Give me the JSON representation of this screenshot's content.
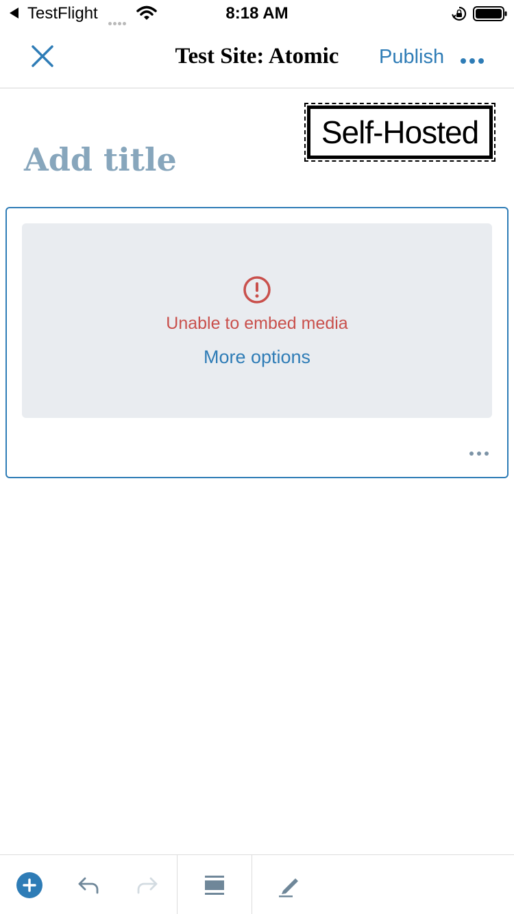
{
  "status_bar": {
    "back_app": "TestFlight",
    "time": "8:18 AM",
    "icons": [
      "back-arrow-icon",
      "signal-dots-icon",
      "wifi-icon",
      "orientation-lock-icon",
      "battery-icon"
    ]
  },
  "header": {
    "title": "Test Site: Atomic",
    "publish_label": "Publish",
    "icons": [
      "close-icon",
      "more-horizontal-icon"
    ]
  },
  "stamp": {
    "text": "Self-Hosted"
  },
  "editor": {
    "title_placeholder": "Add title",
    "embed_block": {
      "error_text": "Unable to embed media",
      "more_options_label": "More options",
      "icons": [
        "warning-circle-icon",
        "block-more-icon"
      ]
    }
  },
  "toolbar": {
    "icons": [
      "add-block-icon",
      "undo-icon",
      "redo-icon",
      "block-navigation-icon",
      "edit-icon"
    ]
  },
  "colors": {
    "accent": "#2e7cb6",
    "error": "#c9504c",
    "placeholder": "#87a6bc",
    "panel": "#e9ecf0"
  }
}
